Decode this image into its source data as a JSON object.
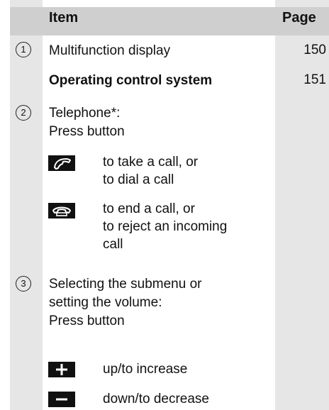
{
  "header": {
    "item": "Item",
    "page": "Page"
  },
  "rows": [
    {
      "marker": "1",
      "text": "Multifunction display",
      "page": "150"
    },
    {
      "text": "Operating control system",
      "page": "151"
    },
    {
      "marker": "2",
      "lines": [
        "Telephone*:",
        "Press button"
      ],
      "buttons": [
        {
          "icon": "phone-answer-icon",
          "lines": [
            "to take a call, or",
            "to dial a call"
          ]
        },
        {
          "icon": "phone-hangup-icon",
          "lines": [
            "to end a call, or",
            "to reject an incoming",
            "call"
          ]
        }
      ]
    },
    {
      "marker": "3",
      "lines": [
        "Selecting the submenu or",
        "setting the volume:",
        "Press button"
      ],
      "buttons": [
        {
          "icon": "plus-icon",
          "text": "up/to increase"
        },
        {
          "icon": "minus-icon",
          "text": "down/to decrease"
        }
      ]
    }
  ]
}
